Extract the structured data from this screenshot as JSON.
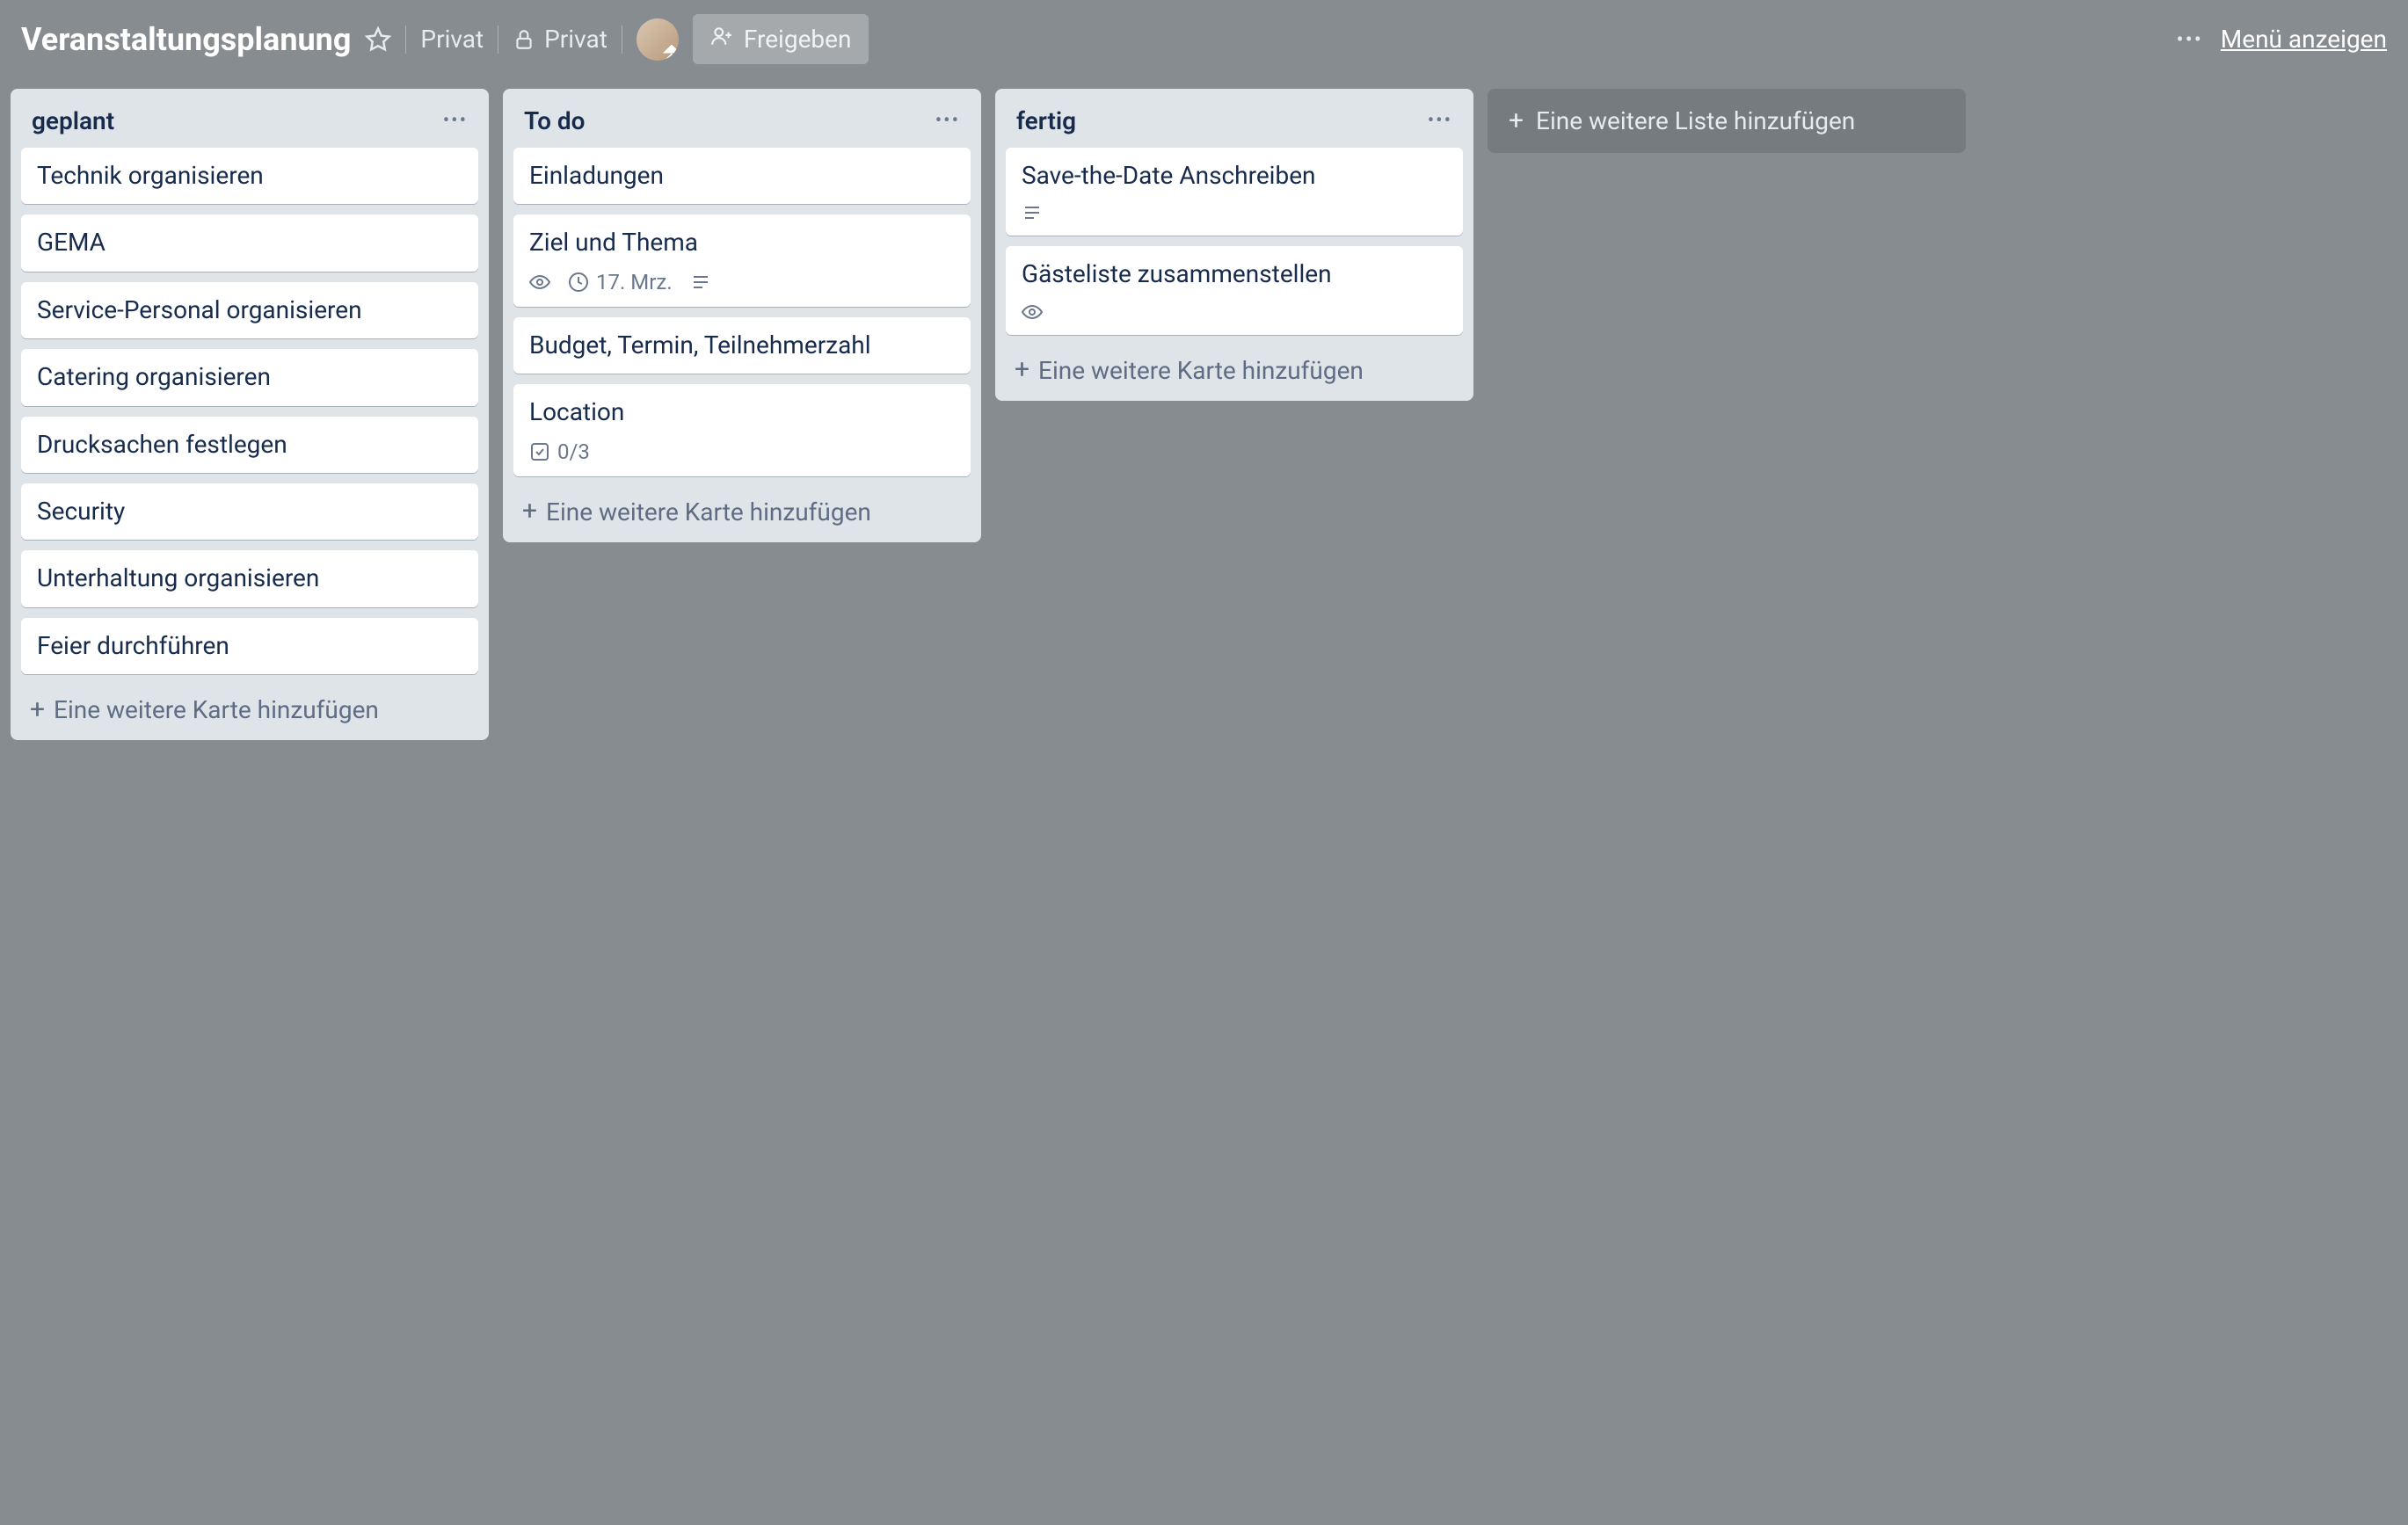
{
  "header": {
    "board_title": "Veranstaltungsplanung",
    "visibility_label": "Privat",
    "privacy_label": "Privat",
    "share_label": "Freigeben",
    "menu_label": "Menü anzeigen"
  },
  "lists": [
    {
      "title": "geplant",
      "cards": [
        {
          "title": "Technik organisieren",
          "badges": []
        },
        {
          "title": "GEMA",
          "badges": []
        },
        {
          "title": "Service-Personal organisieren",
          "badges": []
        },
        {
          "title": "Catering organisieren",
          "badges": []
        },
        {
          "title": "Drucksachen festlegen",
          "badges": []
        },
        {
          "title": "Security",
          "badges": []
        },
        {
          "title": "Unterhaltung organisieren",
          "badges": []
        },
        {
          "title": "Feier durchführen",
          "badges": []
        }
      ],
      "add_card_label": "Eine weitere Karte hinzufügen"
    },
    {
      "title": "To do",
      "cards": [
        {
          "title": "Einladungen",
          "badges": []
        },
        {
          "title": "Ziel und Thema",
          "badges": [
            {
              "type": "watch"
            },
            {
              "type": "due",
              "text": "17. Mrz."
            },
            {
              "type": "description"
            }
          ]
        },
        {
          "title": "Budget, Termin, Teilnehmerzahl",
          "badges": []
        },
        {
          "title": "Location",
          "badges": [
            {
              "type": "checklist",
              "text": "0/3"
            }
          ]
        }
      ],
      "add_card_label": "Eine weitere Karte hinzufügen"
    },
    {
      "title": "fertig",
      "cards": [
        {
          "title": "Save-the-Date Anschreiben",
          "badges": [
            {
              "type": "description"
            }
          ]
        },
        {
          "title": "Gästeliste zusammenstellen",
          "badges": [
            {
              "type": "watch"
            }
          ]
        }
      ],
      "add_card_label": "Eine weitere Karte hinzufügen"
    }
  ],
  "add_list_label": "Eine weitere Liste hinzufügen"
}
